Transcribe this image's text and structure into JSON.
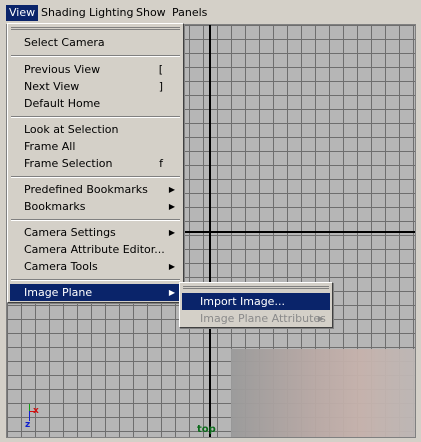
{
  "menubar": {
    "items": [
      "View",
      "Shading",
      "Lighting",
      "Show",
      "Panels"
    ]
  },
  "view_menu": {
    "items": [
      {
        "label": "Select Camera"
      },
      {
        "label": "Previous View",
        "shortcut": "["
      },
      {
        "label": "Next View",
        "shortcut": "]"
      },
      {
        "label": "Default Home"
      },
      {
        "label": "Look at Selection"
      },
      {
        "label": "Frame All"
      },
      {
        "label": "Frame Selection",
        "shortcut": "f"
      },
      {
        "label": "Predefined Bookmarks"
      },
      {
        "label": "Bookmarks"
      },
      {
        "label": "Camera Settings"
      },
      {
        "label": "Camera Attribute Editor..."
      },
      {
        "label": "Camera Tools"
      },
      {
        "label": "Image Plane"
      }
    ]
  },
  "image_plane_submenu": {
    "items": [
      {
        "label": "Import Image..."
      },
      {
        "label": "Image Plane Attributes"
      }
    ]
  },
  "viewport": {
    "camera_label": "top",
    "axis_x": "x",
    "axis_z": "z"
  },
  "colors": {
    "highlight": "#0a246a",
    "menu_bg": "#d4d0c8",
    "grid_bg": "#b6b6b6",
    "camera_label": "#0b6a1a"
  },
  "icons": {
    "submenu_arrow": "triangle-right-icon"
  }
}
